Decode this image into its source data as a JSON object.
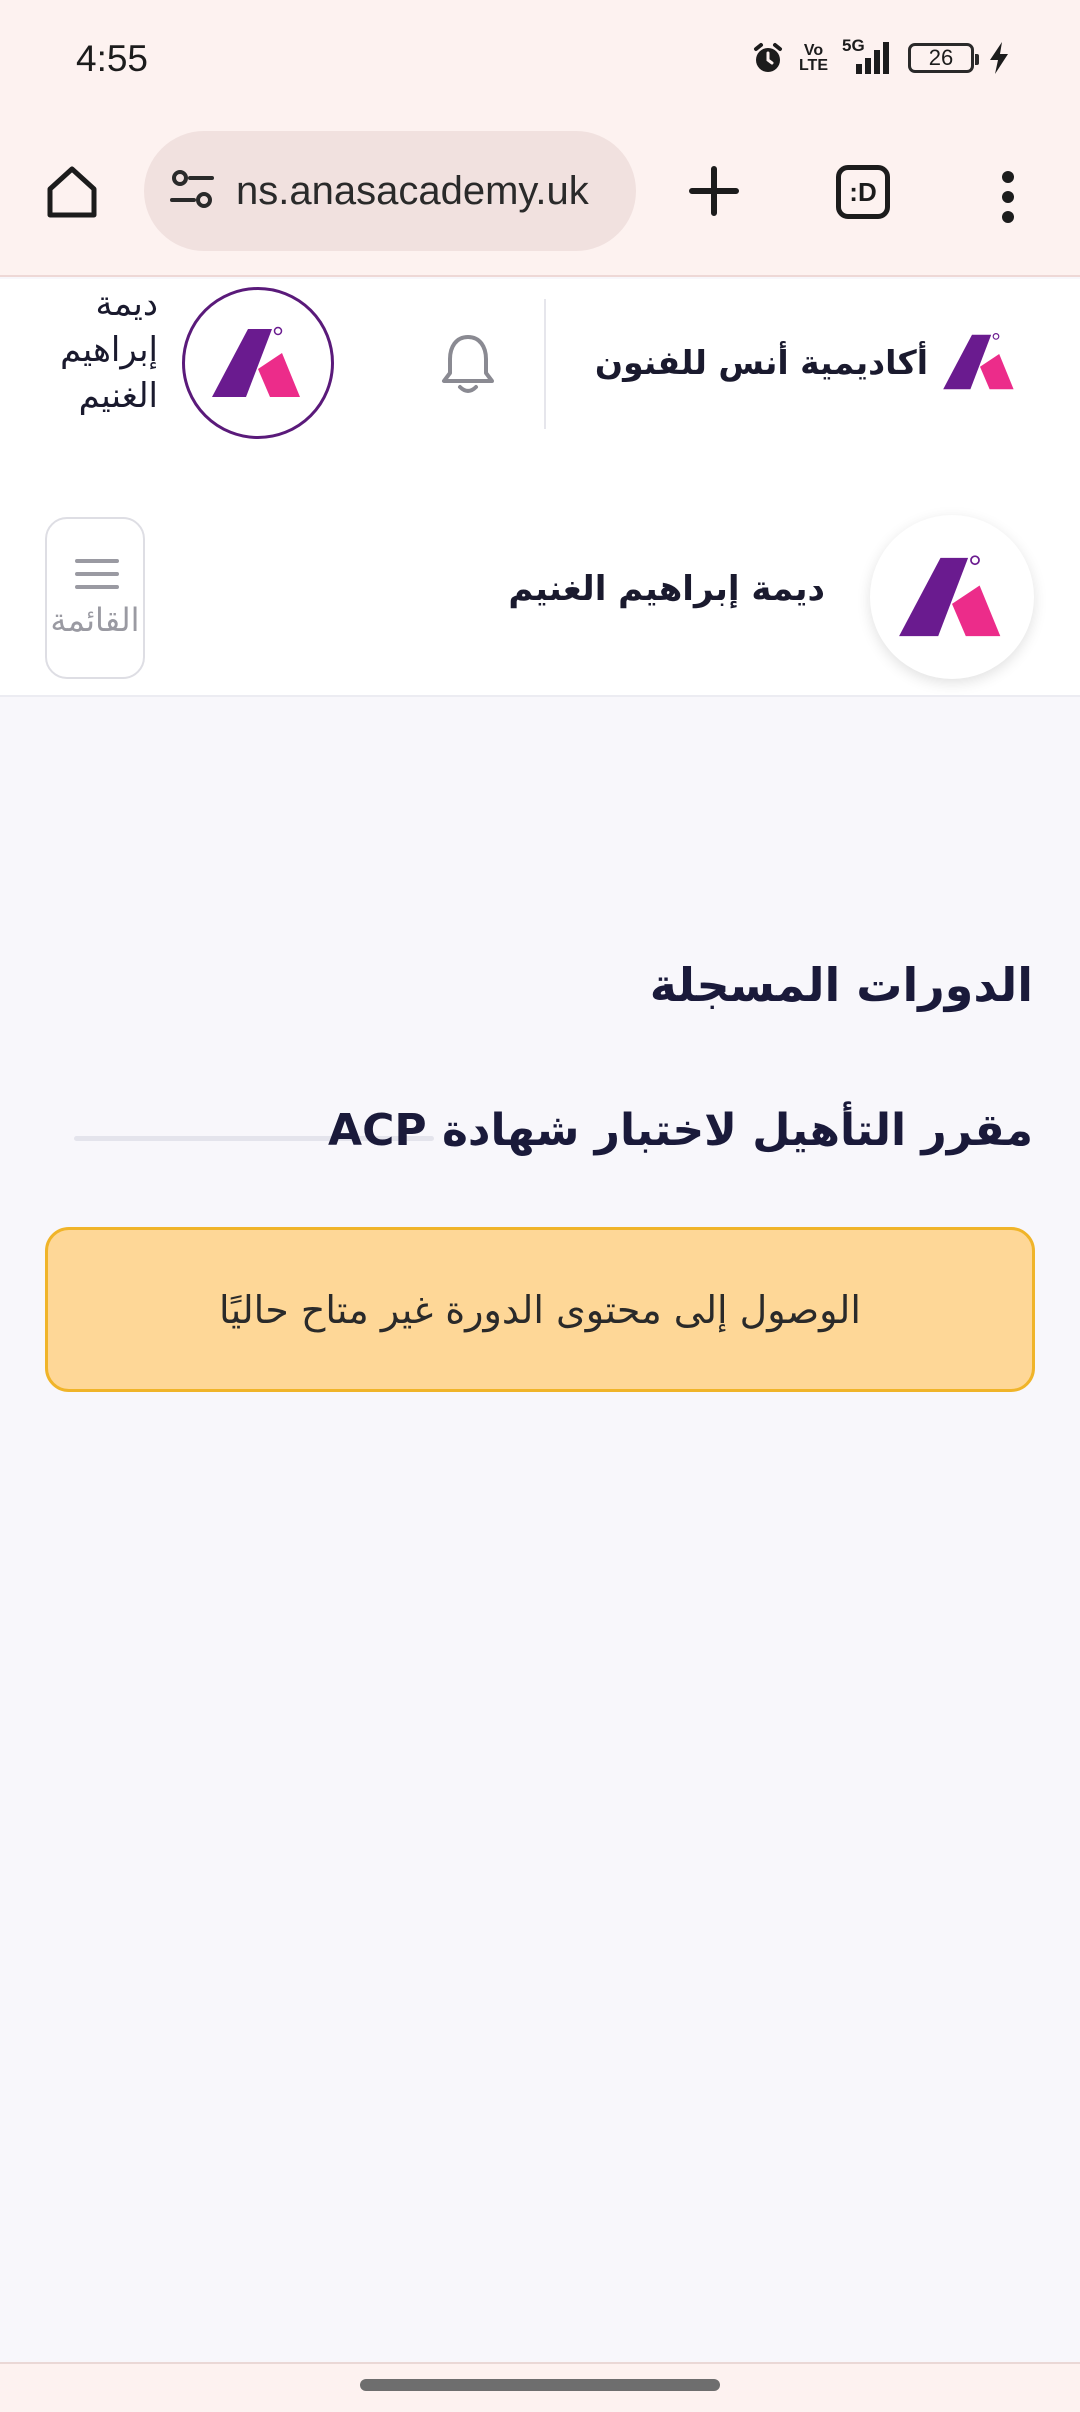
{
  "status_bar": {
    "time": "4:55",
    "network_label": "5G",
    "volte_line1": "Vo",
    "volte_line2": "LTE",
    "battery_level": "26",
    "icons": [
      "alarm-icon",
      "volte-icon",
      "signal-5g-icon",
      "battery-icon",
      "charging-icon"
    ]
  },
  "browser": {
    "url": "ns.anasacademy.uk",
    "tab_button_label": ":D",
    "icons": [
      "home-icon",
      "site-settings-icon",
      "new-tab-icon",
      "tab-switcher-icon",
      "more-options-icon"
    ]
  },
  "header": {
    "brand_name": "أكاديمية أنس للفنون",
    "user_name": "ديمة إبراهيم الغنيم",
    "icons": [
      "academy-logo-icon",
      "bell-icon",
      "user-avatar-icon"
    ]
  },
  "profile": {
    "name": "ديمة إبراهيم الغنيم",
    "menu_label": "القائمة"
  },
  "main": {
    "section_title": "الدورات المسجلة",
    "course_title": "مقرر التأهيل لاختبار شهادة ACP",
    "course_progress": 0,
    "alert_text": "الوصول إلى محتوى الدورة غير متاح حاليًا"
  },
  "colors": {
    "logo_purple": "#6a1b8f",
    "logo_pink": "#ec2c8a",
    "alert_bg": "#fed797",
    "alert_border": "#f0b429",
    "browser_chrome": "#fdf2f0"
  }
}
